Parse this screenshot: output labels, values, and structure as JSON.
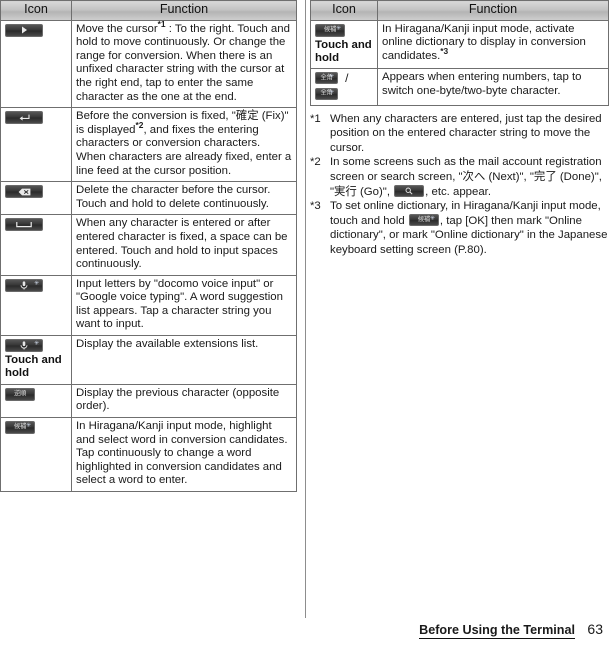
{
  "table_left": {
    "headers": {
      "icon": "Icon",
      "function": "Function"
    },
    "rows": [
      {
        "icon": "arrow-right-key-icon",
        "icon_label": "",
        "function": "Move the cursor*1 : To the right. Touch and hold to move continuously. Or change the range for conversion. When there is an unfixed character string with the cursor at the right end, tap to enter the same character as the one at the end.",
        "note_ref": "*1"
      },
      {
        "icon": "enter-key-icon",
        "icon_label": "",
        "function": "Before the conversion is fixed, \"確定 (Fix)\" is displayed*2, and fixes the entering characters or conversion characters. When characters are already fixed, enter a line feed at the cursor position.",
        "note_ref": "*2"
      },
      {
        "icon": "backspace-key-icon",
        "icon_label": "",
        "function": "Delete the character before the cursor. Touch and hold to delete continuously.",
        "note_ref": ""
      },
      {
        "icon": "space-key-icon",
        "icon_label": "",
        "function": "When any character is entered or after entered character is fixed, a space can be entered. Touch and hold to input spaces continuously.",
        "note_ref": ""
      },
      {
        "icon": "microphone-key-icon",
        "icon_label": "",
        "function": "Input letters by \"docomo voice input\" or \"Google voice typing\". A word suggestion list appears. Tap a character string you want to input.",
        "note_ref": ""
      },
      {
        "icon": "microphone-key-icon",
        "icon_label": "Touch and hold",
        "function": "Display the available extensions list.",
        "note_ref": ""
      },
      {
        "icon": "reverse-order-key-icon",
        "icon_label": "",
        "function": "Display the previous character (opposite order).",
        "note_ref": ""
      },
      {
        "icon": "candidate-key-icon",
        "icon_label": "",
        "function": "In Hiragana/Kanji input mode, highlight and select word in conversion candidates. Tap continuously to change a word highlighted in conversion candidates and select a word to enter.",
        "note_ref": ""
      }
    ]
  },
  "table_right": {
    "headers": {
      "icon": "Icon",
      "function": "Function"
    },
    "rows": [
      {
        "icon": "candidate-key-icon",
        "icon_label": "Touch and hold",
        "function": "In Hiragana/Kanji input mode, activate online dictionary to display in conversion candidates.*3",
        "note_ref": "*3"
      },
      {
        "icon": "zenkaku-key-icon-pair",
        "icon_label": "",
        "function": "Appears when entering numbers, tap to switch one-byte/two-byte character.",
        "note_ref": ""
      }
    ]
  },
  "notes": [
    {
      "mark": "*1",
      "text": "When any characters are entered, just tap the desired position on the entered character string to move the cursor."
    },
    {
      "mark": "*2",
      "text_part1": "In some screens such as the mail account registration screen or search screen, \"次へ (Next)\", \"完了 (Done)\", \"実行 (Go)\", ",
      "text_part2": ", etc. appear.",
      "inline_icon": "search-key-icon"
    },
    {
      "mark": "*3",
      "text_part1": "To set online dictionary, in Hiragana/Kanji input mode, touch and hold ",
      "text_part2": ", tap [OK] then mark \"Online dictionary\", or mark \"Online dictionary\" in the Japanese keyboard setting screen (P.80).",
      "inline_icon": "candidate-key-icon"
    }
  ],
  "key_glyphs": {
    "zenkaku": "全角",
    "reverse_order": "逆順",
    "candidate": "候補"
  },
  "footer": {
    "chapter": "Before Using the Terminal",
    "page_number": "63"
  }
}
